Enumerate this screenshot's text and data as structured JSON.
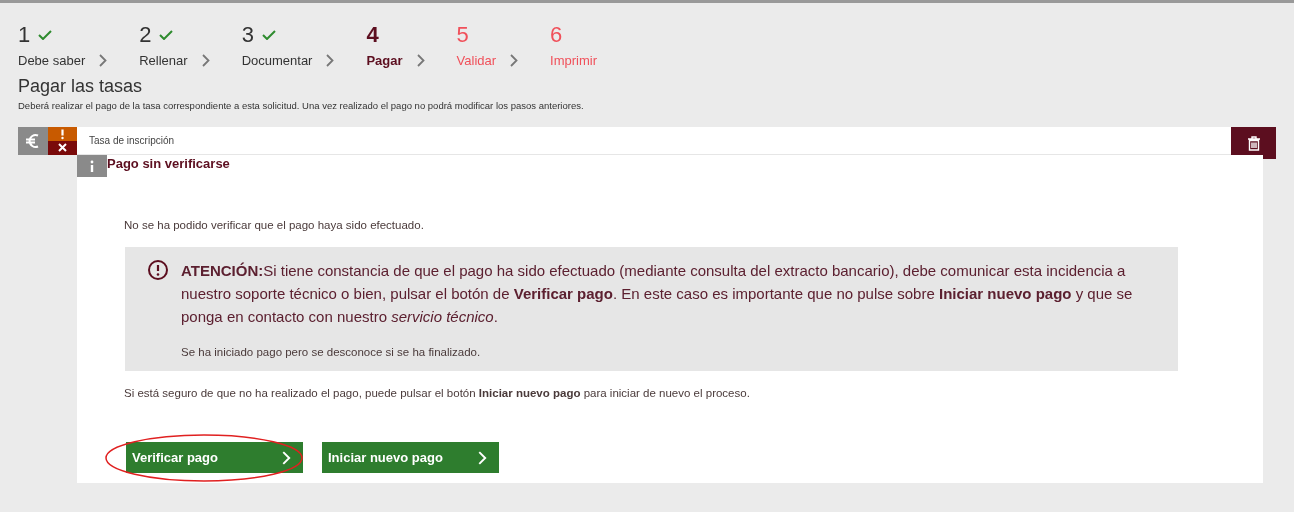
{
  "steps": [
    {
      "number": "1",
      "label": "Debe saber",
      "done": true,
      "selected": false
    },
    {
      "number": "2",
      "label": "Rellenar",
      "done": true,
      "selected": false
    },
    {
      "number": "3",
      "label": "Documentar",
      "done": true,
      "selected": false
    },
    {
      "number": "4",
      "label": "Pagar",
      "done": false,
      "selected": true
    },
    {
      "number": "5",
      "label": "Validar",
      "done": false,
      "selected": false
    },
    {
      "number": "6",
      "label": "Imprimir",
      "done": false,
      "selected": false
    }
  ],
  "page": {
    "title": "Pagar las tasas",
    "subtitle": "Deberá realizar el pago de la tasa correspondiente a esta solicitud. Una vez realizado el pago no podrá modificar los pasos anteriores."
  },
  "fee": {
    "name": "Tasa de inscripción",
    "status_title": "Pago sin verificarse",
    "message": "No se ha podido verificar que el pago haya sido efectuado.",
    "alert": {
      "text": "**ATENCIÓN:**Si tiene constancia de que el pago ha sido efectuado (mediante consulta del extracto bancario), debe comunicar esta incidencia a nuestro soporte técnico o bien, pulsar el botón de **Verificar pago**. En este caso es importante que no pulse sobre **Iniciar nuevo pago** y que se ponga en contacto con nuestro *servicio técnico*.",
      "note": "Se ha iniciado pago pero se desconoce si se ha finalizado."
    },
    "hint": "Si está seguro de que no ha realizado el pago, puede pulsar el botón **Iniciar nuevo pago** para iniciar de nuevo el proceso.",
    "buttons": [
      {
        "label": "Verificar pago",
        "highlighted": true
      },
      {
        "label": "Iniciar nuevo pago",
        "highlighted": false
      }
    ]
  }
}
